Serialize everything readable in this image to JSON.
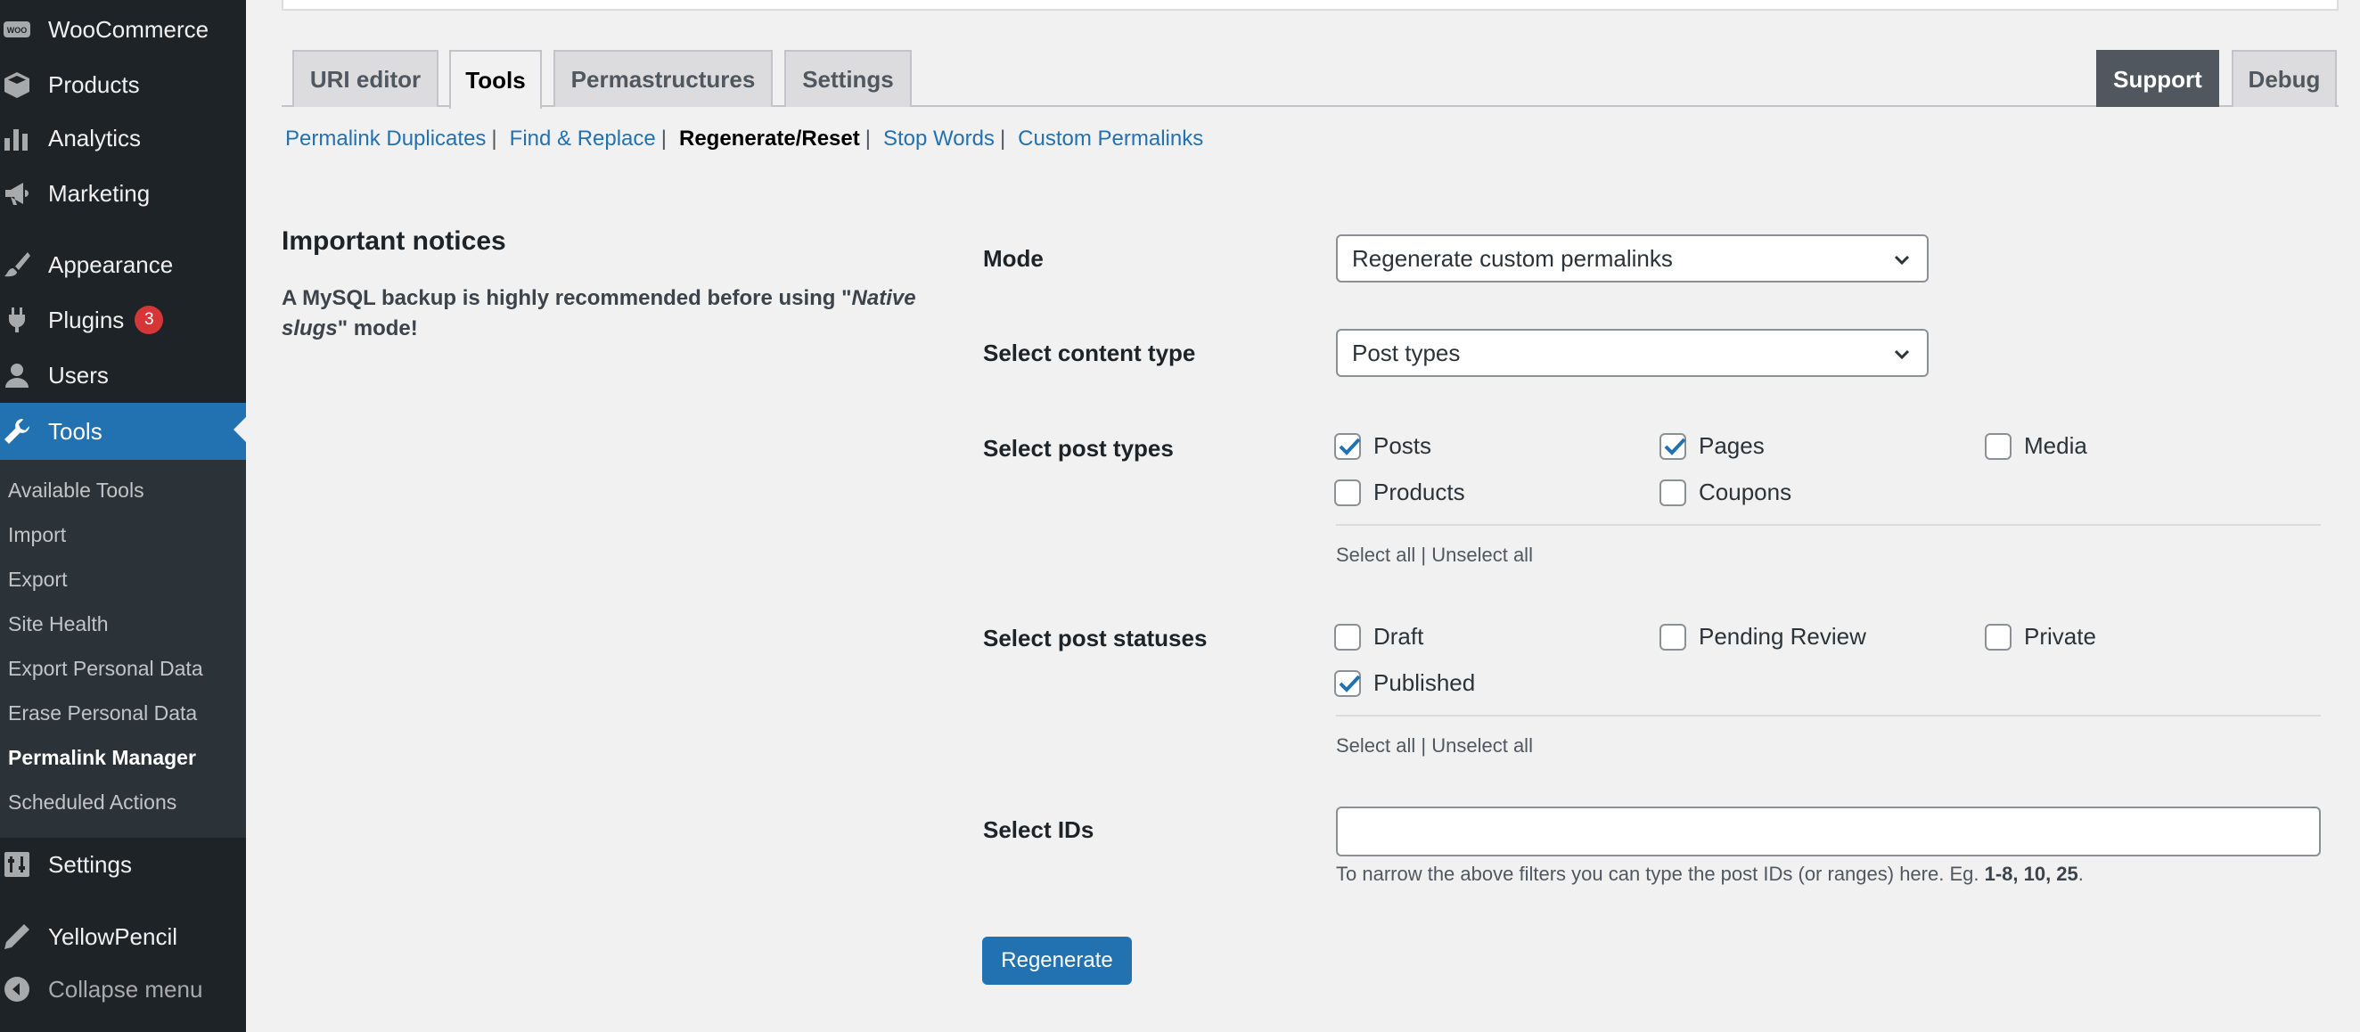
{
  "sidebar": {
    "items": [
      {
        "label": "WooCommerce",
        "icon": "woo-icon"
      },
      {
        "label": "Products",
        "icon": "box-icon"
      },
      {
        "label": "Analytics",
        "icon": "bar-chart-icon"
      },
      {
        "label": "Marketing",
        "icon": "megaphone-icon"
      },
      {
        "label": "Appearance",
        "icon": "paintbrush-icon"
      },
      {
        "label": "Plugins",
        "icon": "plug-icon",
        "badge": "3"
      },
      {
        "label": "Users",
        "icon": "user-icon"
      },
      {
        "label": "Tools",
        "icon": "wrench-icon"
      },
      {
        "label": "Settings",
        "icon": "sliders-icon"
      },
      {
        "label": "YellowPencil",
        "icon": "pencil-icon"
      },
      {
        "label": "Collapse menu",
        "icon": "collapse-icon"
      }
    ],
    "submenu": [
      "Available Tools",
      "Import",
      "Export",
      "Site Health",
      "Export Personal Data",
      "Erase Personal Data",
      "Permalink Manager",
      "Scheduled Actions"
    ]
  },
  "tabs": {
    "left": [
      "URI editor",
      "Tools",
      "Permastructures",
      "Settings"
    ],
    "right": [
      "Support",
      "Debug"
    ]
  },
  "subnav": [
    "Permalink Duplicates",
    "Find & Replace",
    "Regenerate/Reset",
    "Stop Words",
    "Custom Permalinks"
  ],
  "notices": {
    "title": "Important notices",
    "text_before": "A MySQL backup is highly recommended before using \"",
    "text_em": "Native slugs",
    "text_after": "\" mode!"
  },
  "form": {
    "mode_label": "Mode",
    "mode_value": "Regenerate custom permalinks",
    "content_type_label": "Select content type",
    "content_type_value": "Post types",
    "post_types_label": "Select post types",
    "post_types": [
      {
        "label": "Posts",
        "checked": true
      },
      {
        "label": "Pages",
        "checked": true
      },
      {
        "label": "Media",
        "checked": false
      },
      {
        "label": "Products",
        "checked": false
      },
      {
        "label": "Coupons",
        "checked": false
      }
    ],
    "post_statuses_label": "Select post statuses",
    "post_statuses": [
      {
        "label": "Draft",
        "checked": false
      },
      {
        "label": "Pending Review",
        "checked": false
      },
      {
        "label": "Private",
        "checked": false
      },
      {
        "label": "Published",
        "checked": true
      }
    ],
    "select_all": "Select all",
    "unselect_all": "Unselect all",
    "ids_label": "Select IDs",
    "ids_value": "",
    "ids_help": "To narrow the above filters you can type the post IDs (or ranges) here. Eg. ",
    "ids_example": "1-8, 10, 25",
    "ids_help_end": ".",
    "submit_label": "Regenerate"
  },
  "colors": {
    "accent": "#2271b1",
    "sidebar": "#1d2327",
    "badge": "#d63638"
  }
}
